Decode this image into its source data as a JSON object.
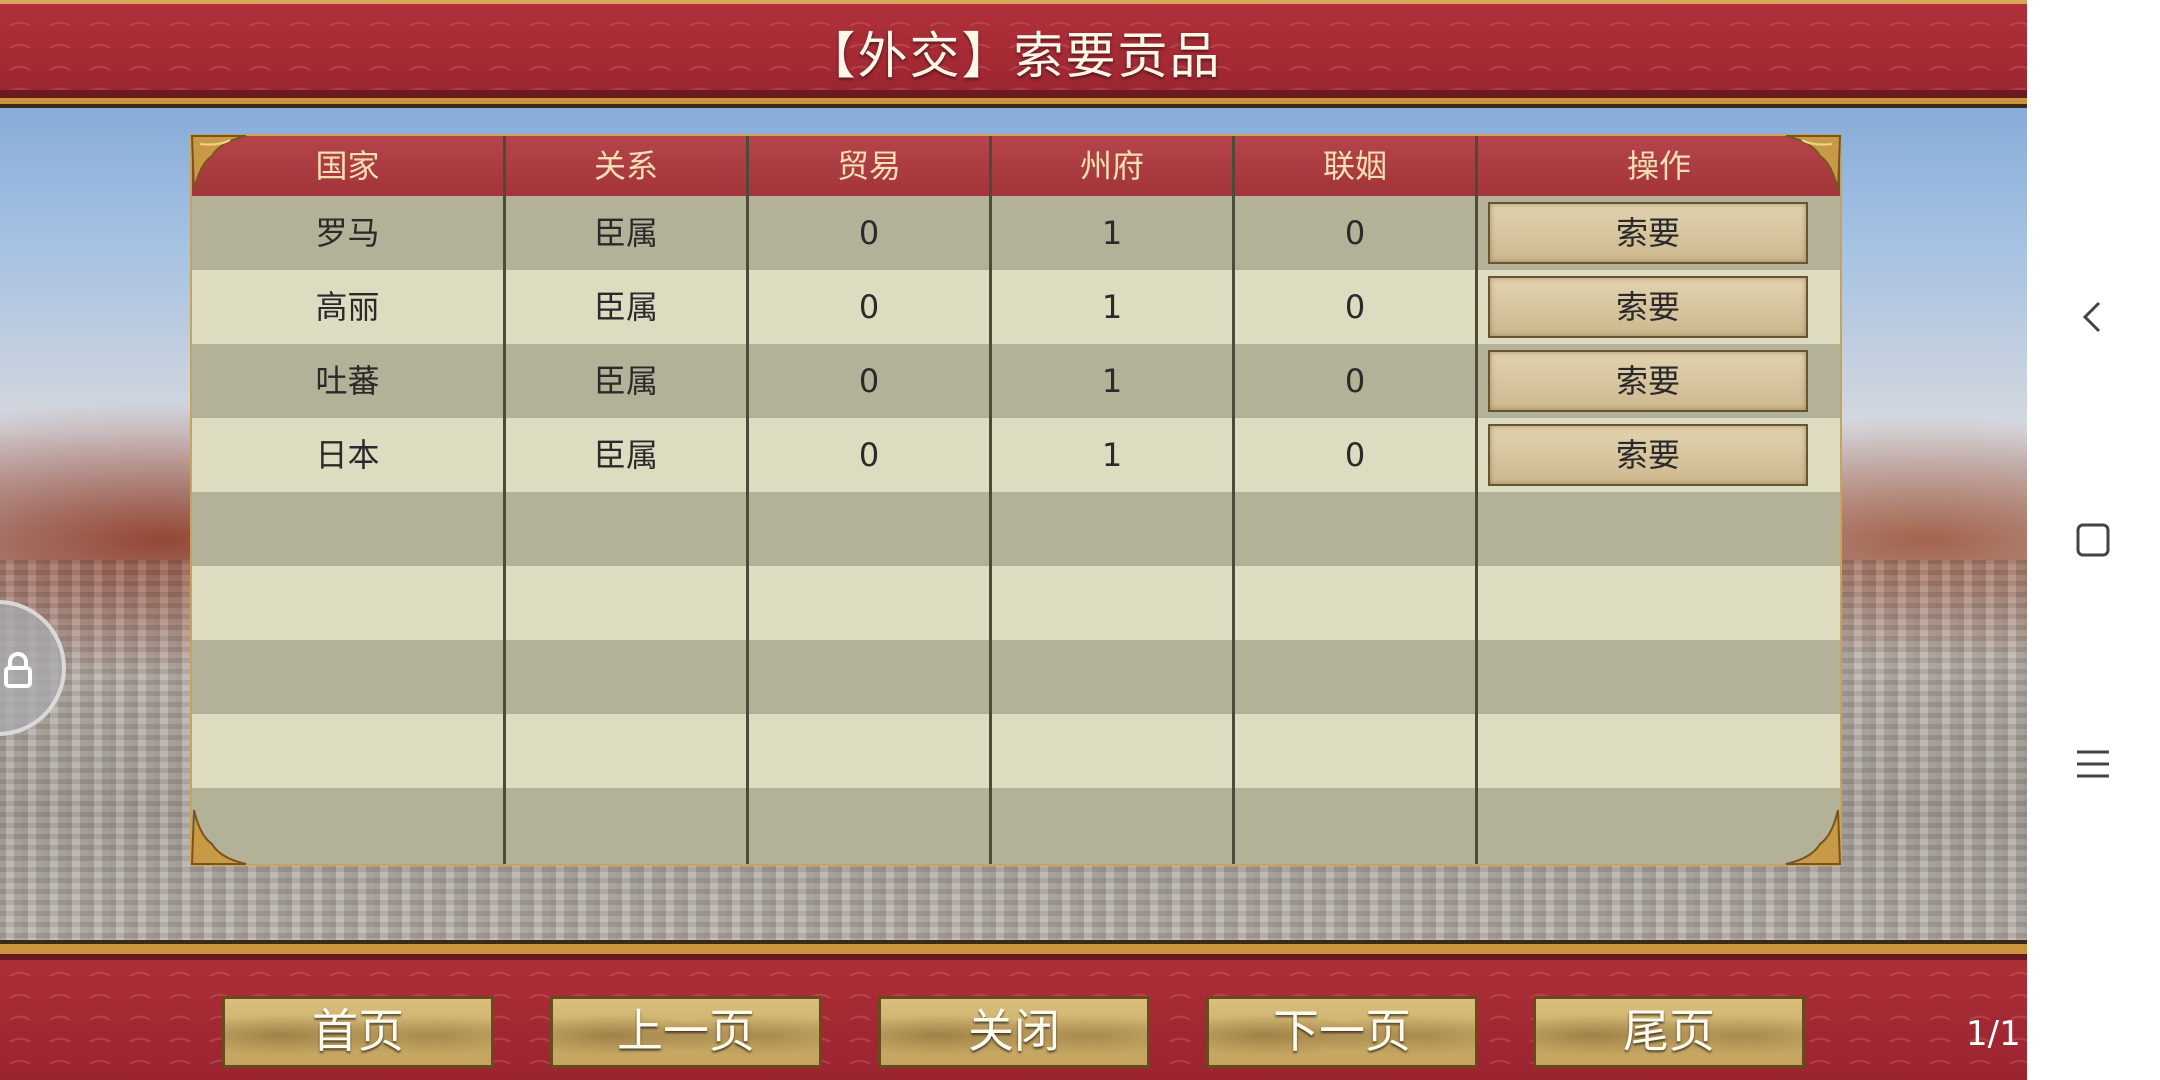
{
  "header": {
    "title": "【外交】索要贡品"
  },
  "table": {
    "columns": [
      "国家",
      "关系",
      "贸易",
      "州府",
      "联姻",
      "操作"
    ],
    "rows": [
      {
        "country": "罗马",
        "relation": "臣属",
        "trade": "0",
        "prefecture": "1",
        "marriage": "0",
        "action": "索要"
      },
      {
        "country": "高丽",
        "relation": "臣属",
        "trade": "0",
        "prefecture": "1",
        "marriage": "0",
        "action": "索要"
      },
      {
        "country": "吐蕃",
        "relation": "臣属",
        "trade": "0",
        "prefecture": "1",
        "marriage": "0",
        "action": "索要"
      },
      {
        "country": "日本",
        "relation": "臣属",
        "trade": "0",
        "prefecture": "1",
        "marriage": "0",
        "action": "索要"
      }
    ]
  },
  "footer": {
    "first_label": "首页",
    "prev_label": "上一页",
    "close_label": "关闭",
    "next_label": "下一页",
    "last_label": "尾页",
    "page_indicator": "1/1"
  },
  "icons": {
    "side": "lock-icon",
    "android_back": "back-icon",
    "android_home": "home-icon",
    "android_menu": "menu-icon"
  },
  "colors": {
    "banner_red": "#a02a33",
    "gold_trim": "#c9953f",
    "header_text": "#f3dfb2"
  }
}
